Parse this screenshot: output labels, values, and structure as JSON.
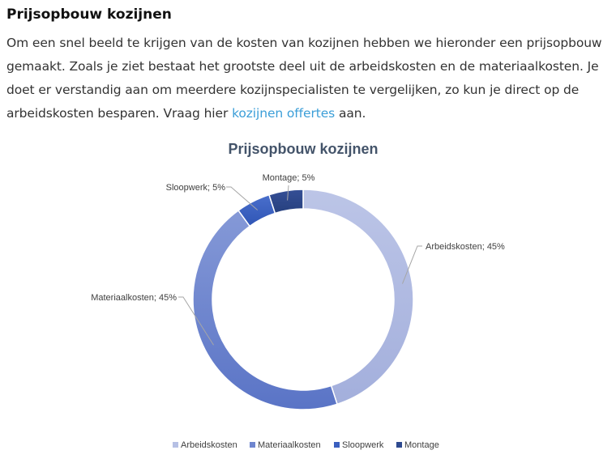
{
  "article": {
    "heading": "Prijsopbouw kozijnen",
    "paragraph_before_link": "Om een snel beeld te krijgen van de kosten van kozijnen hebben we hieronder een prijsopbouw gemaakt. Zoals je ziet bestaat het grootste deel uit de arbeidskosten en de materiaalkosten. Je doet er verstandig aan om meerdere kozijnspecialisten te vergelijken, zo kun je direct op de arbeidskosten besparen. Vraag hier ",
    "link_text": "kozijnen offertes",
    "paragraph_after_link": " aan.",
    "link_color": "#3b9ed8"
  },
  "chart_data": {
    "type": "pie",
    "variant": "donut",
    "title": "Prijsopbouw kozijnen",
    "legend_position": "bottom",
    "slices": [
      {
        "name": "Arbeidskosten",
        "value": 45,
        "label": "Arbeidskosten; 45%",
        "color": "#b6c0e4"
      },
      {
        "name": "Materiaalkosten",
        "value": 45,
        "label": "Materiaalkosten; 45%",
        "color": "#6f86cf"
      },
      {
        "name": "Sloopwerk",
        "value": 5,
        "label": "Sloopwerk; 5%",
        "color": "#3a5fbf"
      },
      {
        "name": "Montage",
        "value": 5,
        "label": "Montage; 5%",
        "color": "#2e4a8f"
      }
    ]
  }
}
